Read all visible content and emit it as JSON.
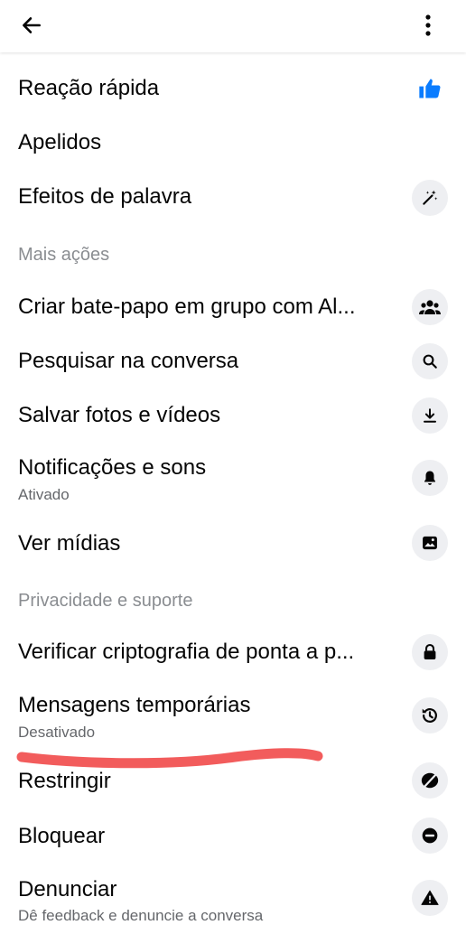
{
  "header": {
    "back_icon": "arrow-left-icon",
    "menu_icon": "more-vertical-icon"
  },
  "colors": {
    "accent": "#0a7cff",
    "annotation": "#f25c5c"
  },
  "items_top": [
    {
      "label": "Reação rápida",
      "icon": "thumbs-up-icon"
    },
    {
      "label": "Apelidos"
    },
    {
      "label": "Efeitos de palavra",
      "icon": "magic-wand-icon"
    }
  ],
  "section_more": {
    "title": "Mais ações"
  },
  "items_more": [
    {
      "label": "Criar bate-papo em grupo com Al...",
      "icon": "group-icon"
    },
    {
      "label": "Pesquisar na conversa",
      "icon": "search-icon"
    },
    {
      "label": "Salvar fotos e vídeos",
      "icon": "download-icon"
    },
    {
      "label": "Notificações e sons",
      "sublabel": "Ativado",
      "icon": "bell-icon"
    },
    {
      "label": "Ver mídias",
      "icon": "image-icon"
    }
  ],
  "section_privacy": {
    "title": "Privacidade e suporte"
  },
  "items_privacy": [
    {
      "label": "Verificar criptografia de ponta a p...",
      "icon": "lock-icon"
    },
    {
      "label": "Mensagens temporárias",
      "sublabel": "Desativado",
      "icon": "timer-history-icon"
    },
    {
      "label": "Restringir",
      "icon": "restrict-icon"
    },
    {
      "label": "Bloquear",
      "icon": "block-icon"
    },
    {
      "label": "Denunciar",
      "sublabel": "Dê feedback e denuncie a conversa",
      "icon": "warning-icon"
    }
  ]
}
